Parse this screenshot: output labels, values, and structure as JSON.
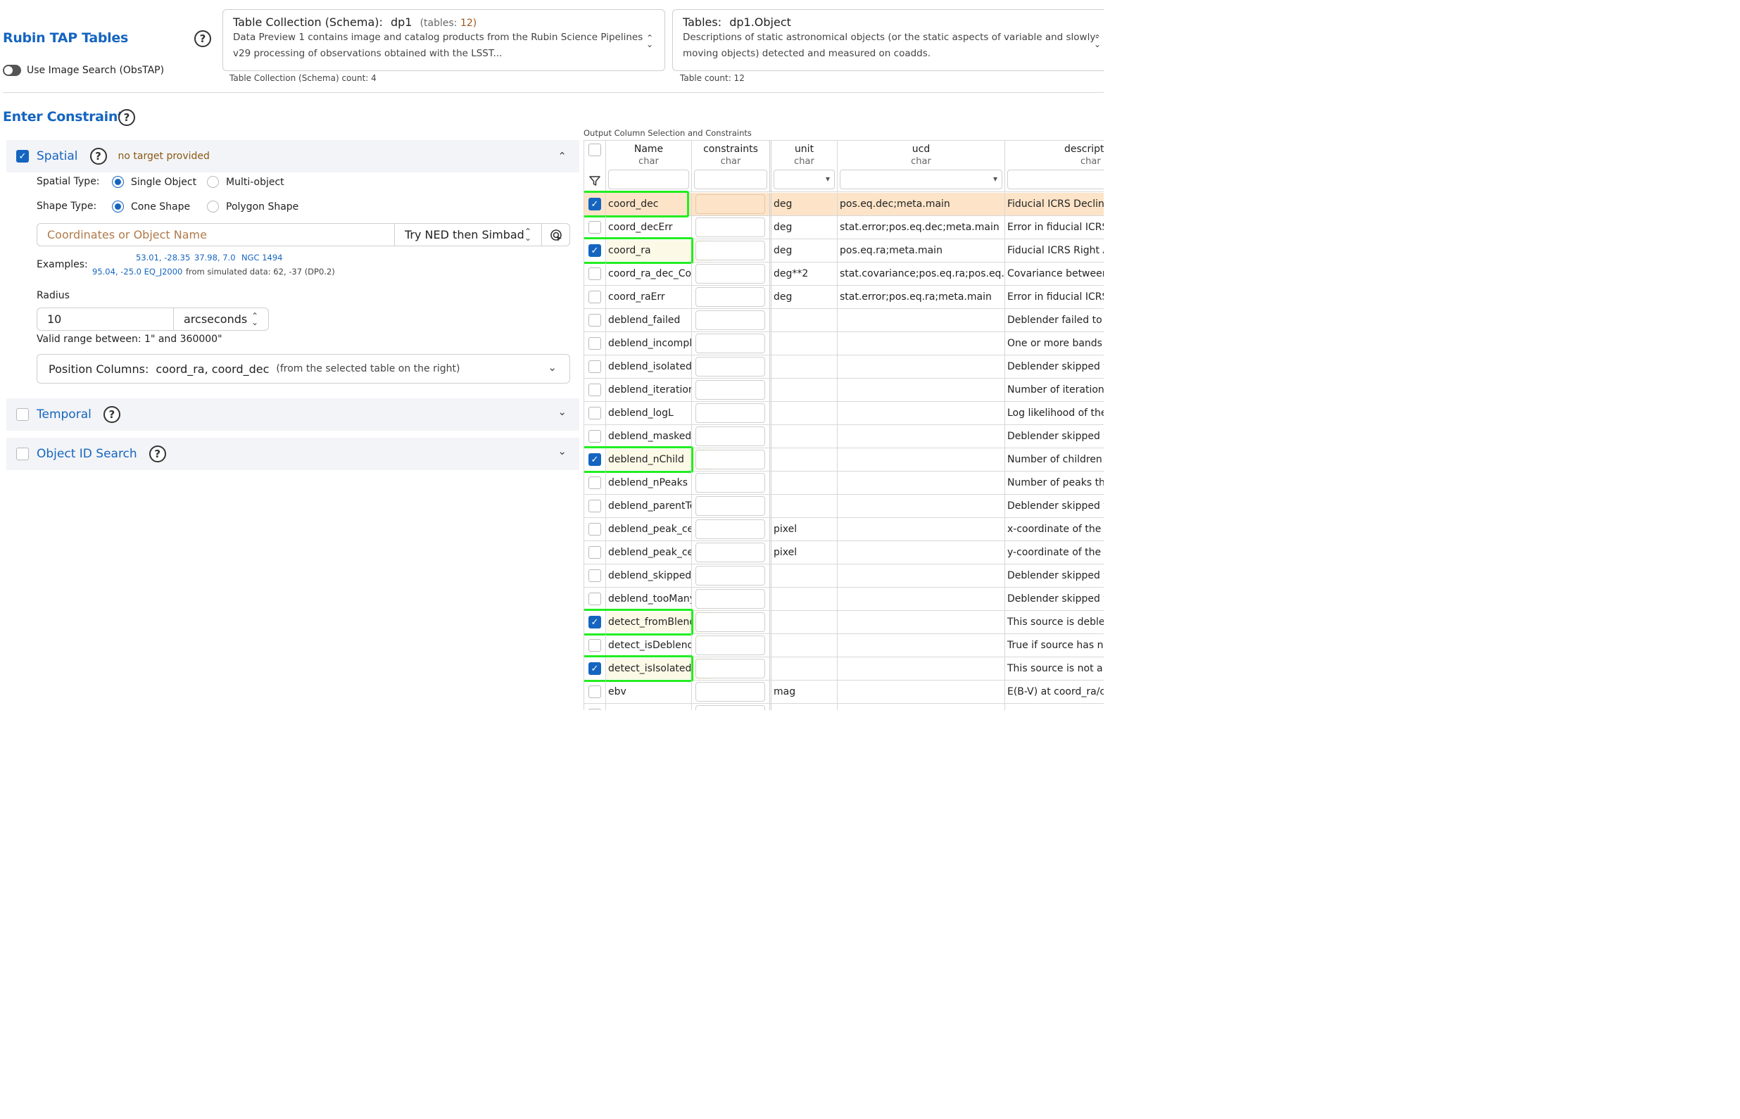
{
  "app": {
    "title": "Rubin TAP Tables",
    "obstap_toggle_label": "Use Image Search (ObsTAP)"
  },
  "schema": {
    "label": "Table Collection (Schema):",
    "value": "dp1",
    "tables_prefix": "(tables:",
    "tables_count": "12)",
    "description_line1": "Data Preview 1 contains image and catalog products from the Rubin Science Pipelines",
    "description_line2": "v29 processing of observations obtained with the LSST...",
    "count_label": "Table Collection (Schema) count: 4"
  },
  "table_select": {
    "label": "Tables:",
    "value": "dp1.Object",
    "description_line1": "Descriptions of static astronomical objects (or the static aspects of variable and slowly-",
    "description_line2": "moving objects) detected and measured on coadds.",
    "count_label": "Table count: 12"
  },
  "constraints": {
    "title": "Enter Constraints",
    "spatial": {
      "label": "Spatial",
      "warning": "no target provided",
      "spatial_type_label": "Spatial Type:",
      "single_object": "Single Object",
      "multi_object": "Multi-object",
      "shape_type_label": "Shape Type:",
      "cone_shape": "Cone Shape",
      "polygon_shape": "Polygon Shape",
      "coord_placeholder": "Coordinates or Object Name",
      "resolver": "Try NED then Simbad",
      "examples_label": "Examples:",
      "ex1": "53.01, -28.35",
      "ex2": "37.98, 7.0",
      "ex3": "NGC 1494",
      "ex4": "95.04, -25.0 EQ_J2000",
      "ex_note": "from simulated data: 62, -37 (DP0.2)",
      "radius_label": "Radius",
      "radius_value": "10",
      "radius_unit": "arcseconds",
      "radius_hint": "Valid range between: 1\" and 360000\"",
      "position_columns_label": "Position Columns:",
      "position_columns_value": "coord_ra, coord_dec",
      "position_columns_note": "(from the selected table on the right)"
    },
    "temporal_label": "Temporal",
    "object_id_label": "Object ID Search"
  },
  "columns_table": {
    "caption": "Output Column Selection and Constraints",
    "headers": [
      {
        "name": "Name",
        "type": "char"
      },
      {
        "name": "constraints",
        "type": "char"
      },
      {
        "name": "unit",
        "type": "char"
      },
      {
        "name": "ucd",
        "type": "char"
      },
      {
        "name": "descripti",
        "type": "char"
      }
    ],
    "rows": [
      {
        "name": "coord_dec",
        "unit": "deg",
        "ucd": "pos.eq.dec;meta.main",
        "desc": "Fiducial ICRS Declinati",
        "checked": true,
        "selected": true
      },
      {
        "name": "coord_decErr",
        "unit": "deg",
        "ucd": "stat.error;pos.eq.dec;meta.main",
        "desc": "Error in fiducial ICRS D",
        "checked": false
      },
      {
        "name": "coord_ra",
        "unit": "deg",
        "ucd": "pos.eq.ra;meta.main",
        "desc": "Fiducial ICRS Right Asc",
        "checked": true
      },
      {
        "name": "coord_ra_dec_Cov",
        "unit": "deg**2",
        "ucd": "stat.covariance;pos.eq.ra;pos.eq.dec",
        "desc": "Covariance between fi",
        "checked": false
      },
      {
        "name": "coord_raErr",
        "unit": "deg",
        "ucd": "stat.error;pos.eq.ra;meta.main",
        "desc": "Error in fiducial ICRS R",
        "checked": false
      },
      {
        "name": "deblend_failed",
        "unit": "",
        "ucd": "",
        "desc": "Deblender failed to de",
        "checked": false
      },
      {
        "name": "deblend_incomplete",
        "unit": "",
        "ucd": "",
        "desc": "One or more bands we",
        "checked": false
      },
      {
        "name": "deblend_isolatedParent",
        "unit": "",
        "ucd": "",
        "desc": "Deblender skipped thi",
        "checked": false
      },
      {
        "name": "deblend_iterations",
        "unit": "",
        "ucd": "",
        "desc": "Number of iterations d",
        "checked": false
      },
      {
        "name": "deblend_logL",
        "unit": "",
        "ucd": "",
        "desc": "Log likelihood of the e",
        "checked": false
      },
      {
        "name": "deblend_masked",
        "unit": "",
        "ucd": "",
        "desc": "Deblender skipped thi",
        "checked": false
      },
      {
        "name": "deblend_nChild",
        "unit": "",
        "ucd": "",
        "desc": "Number of children th",
        "checked": true
      },
      {
        "name": "deblend_nPeaks",
        "unit": "",
        "ucd": "",
        "desc": "Number of peaks this",
        "checked": false
      },
      {
        "name": "deblend_parentTooBig",
        "unit": "",
        "ucd": "",
        "desc": "Deblender skipped thi",
        "checked": false
      },
      {
        "name": "deblend_peak_center_x",
        "unit": "pixel",
        "ucd": "",
        "desc": "x-coordinate of the pe",
        "checked": false
      },
      {
        "name": "deblend_peak_center_y",
        "unit": "pixel",
        "ucd": "",
        "desc": "y-coordinate of the pe",
        "checked": false
      },
      {
        "name": "deblend_skipped",
        "unit": "",
        "ucd": "",
        "desc": "Deblender skipped thi",
        "checked": false
      },
      {
        "name": "deblend_tooManyPeaks",
        "unit": "",
        "ucd": "",
        "desc": "Deblender skipped thi",
        "checked": false
      },
      {
        "name": "detect_fromBlend",
        "unit": "",
        "ucd": "",
        "desc": "This source is deblend",
        "checked": true
      },
      {
        "name": "detect_isDeblendedSource",
        "unit": "",
        "ucd": "",
        "desc": "True if source has no c",
        "checked": false
      },
      {
        "name": "detect_isIsolated",
        "unit": "",
        "ucd": "",
        "desc": "This source is not a pa",
        "checked": true
      },
      {
        "name": "ebv",
        "unit": "mag",
        "ucd": "",
        "desc": "E(B-V) at coord_ra/coo",
        "checked": false
      },
      {
        "name": "",
        "unit": "",
        "ucd": "",
        "desc": "",
        "checked": false
      }
    ]
  },
  "colors": {
    "accent": "#1565c0",
    "highlight": "#22ee22",
    "selected_row": "#fde4c8",
    "warning_text": "#8a5a14"
  }
}
